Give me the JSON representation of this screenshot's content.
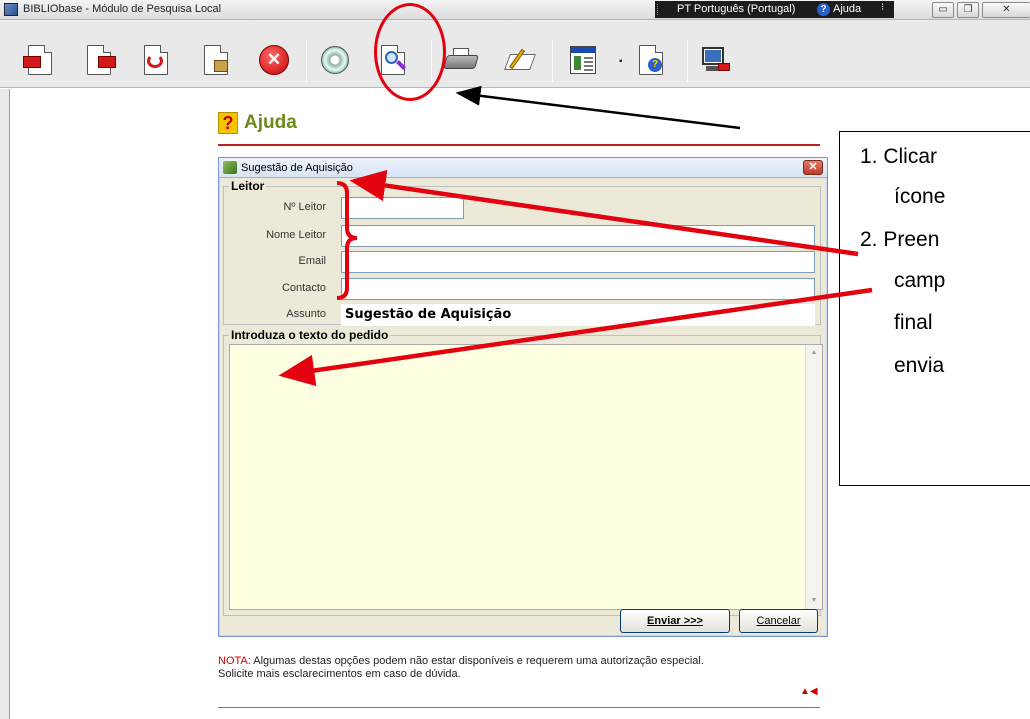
{
  "window": {
    "title": "BIBLIObase - Módulo de Pesquisa Local",
    "language": "PT Português (Portugal)",
    "help_label": "Ajuda",
    "help_glyph": "?",
    "more_glyph": "⁝",
    "minimize_glyph": "▭",
    "restore_glyph": "❐",
    "close_glyph": "✕"
  },
  "toolbar": {
    "buttons": [
      {
        "icon": "document-back-icon"
      },
      {
        "icon": "document-forward-icon"
      },
      {
        "icon": "document-refresh-icon"
      },
      {
        "icon": "document-home-icon"
      },
      {
        "icon": "close-red-icon"
      },
      {
        "icon": "cd-icon"
      },
      {
        "icon": "search-document-icon"
      },
      {
        "icon": "printer-icon"
      },
      {
        "icon": "edit-icon"
      },
      {
        "icon": "window-list-icon"
      },
      {
        "icon": "help-document-icon"
      },
      {
        "icon": "exit-icon"
      }
    ],
    "dropdown_glyph": "▪"
  },
  "help_page": {
    "icon_glyph": "?",
    "title": "Ajuda"
  },
  "dialog": {
    "title": "Sugestão de Aquisição",
    "close_glyph": "✕",
    "reader_group": "Leitor",
    "fields": [
      {
        "label": "Nº Leitor",
        "value": ""
      },
      {
        "label": "Nome Leitor",
        "value": ""
      },
      {
        "label": "Email",
        "value": ""
      },
      {
        "label": "Contacto",
        "value": ""
      },
      {
        "label": "Assunto",
        "value": "Sugestão de Aquisição"
      }
    ],
    "request_group": "Introduza o texto do pedido",
    "request_text": "",
    "scroll_up_glyph": "▲",
    "scroll_down_glyph": "▼",
    "send_button": "Enviar >>>",
    "cancel_button": "Cancelar"
  },
  "note": {
    "label": "NOTA:",
    "text": " Algumas destas opções podem não estar disponíveis e requerem uma autorização especial.",
    "text2": "Solicite mais esclarecimentos em caso de dúvida.",
    "nav_glyph": "▲◀"
  },
  "callout": {
    "lines": [
      "1.  Clicar",
      "ícone",
      "2.  Preen",
      "camp",
      "final",
      "envia"
    ]
  },
  "colors": {
    "annotation_red": "#e3000f",
    "help_title": "#6b8a1a",
    "textarea_bg": "#ffffe1"
  }
}
